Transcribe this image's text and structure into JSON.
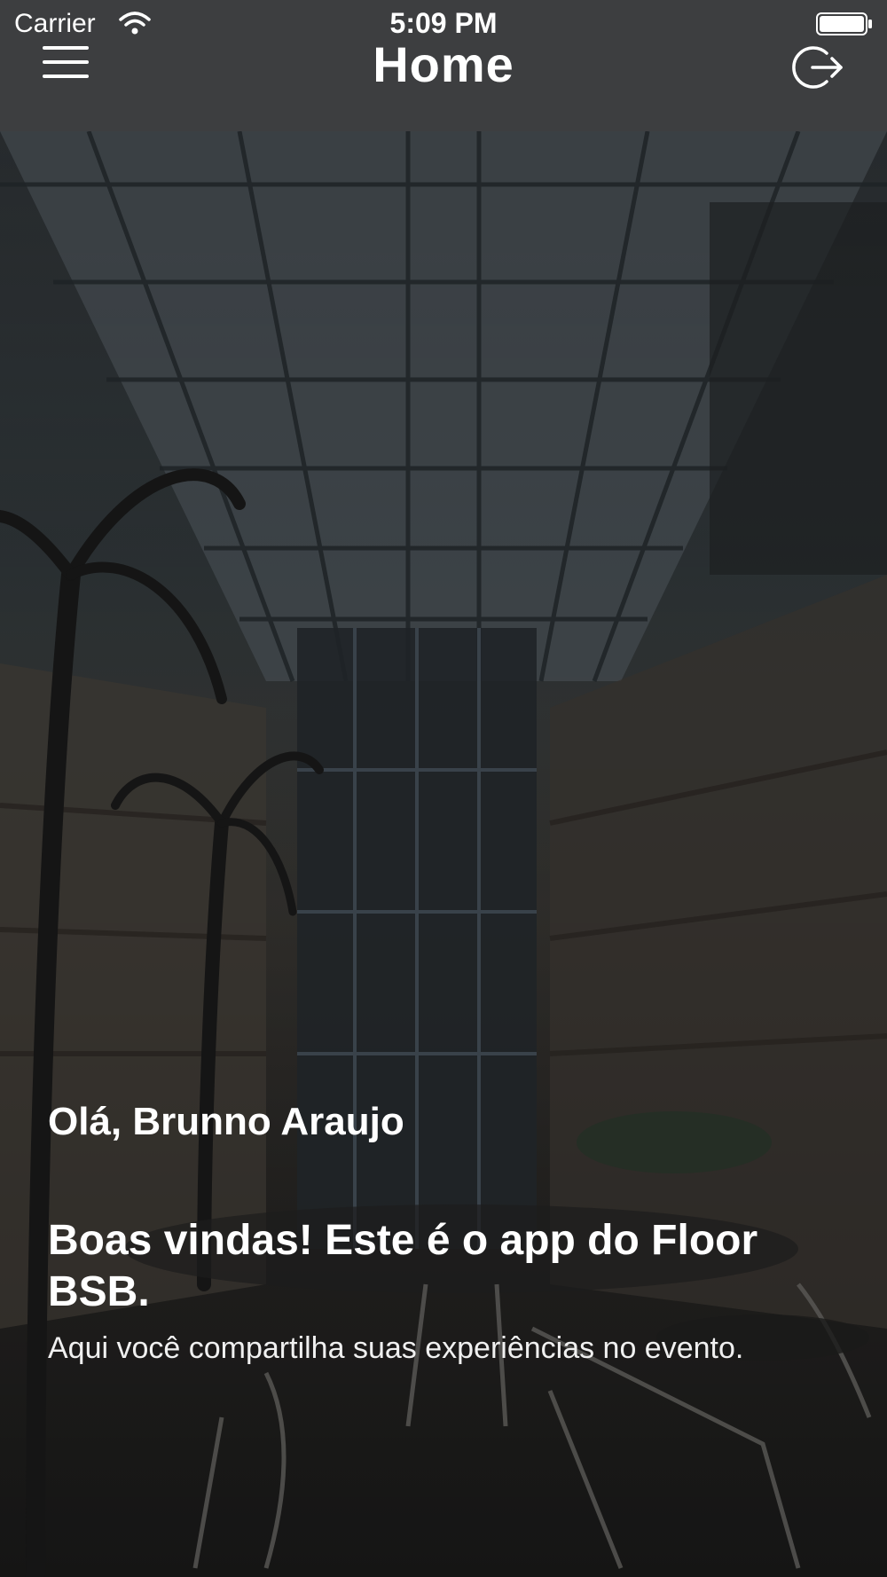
{
  "status_bar": {
    "carrier": "Carrier",
    "time": "5:09 PM"
  },
  "header": {
    "title": "Home",
    "menu_icon": "hamburger-menu-icon",
    "logout_icon": "logout-icon"
  },
  "content": {
    "greeting": "Olá, Brunno Araujo",
    "welcome_title": "Boas vindas! Este é o app do Floor BSB.",
    "welcome_body": "Aqui você compartilha suas experiências no evento."
  },
  "colors": {
    "header_background": "#3d3e40",
    "text": "#ffffff"
  }
}
